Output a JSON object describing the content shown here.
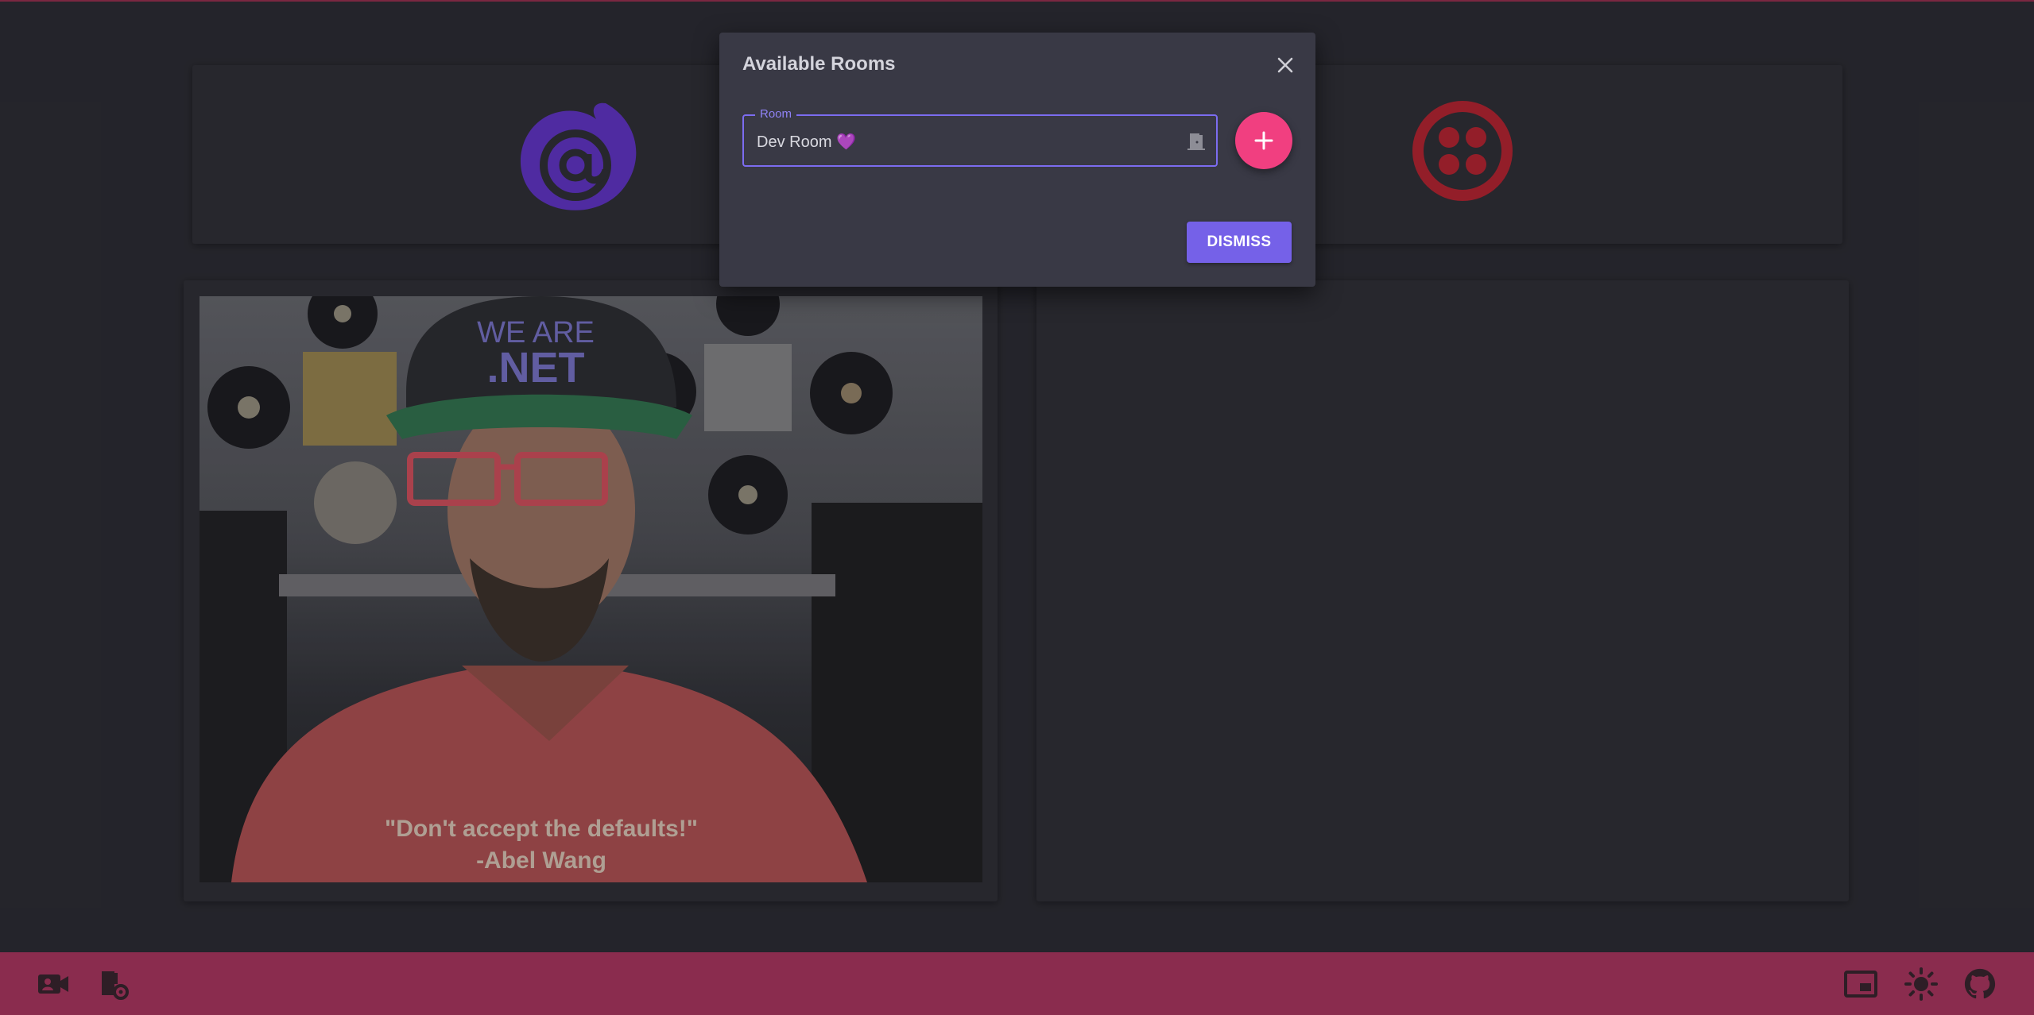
{
  "dialog": {
    "title": "Available Rooms",
    "room_field": {
      "label": "Room",
      "value": "Dev Room 💜",
      "icon": "door-icon"
    },
    "add_button_icon": "plus-icon",
    "close_icon": "close-icon",
    "dismiss_label": "DISMISS"
  },
  "video": {
    "shirt_quote": "\"Don't accept the defaults!\"",
    "shirt_author": "-Abel Wang",
    "hat_top": "WE ARE",
    "hat_bottom": ".NET"
  },
  "logos": {
    "left": "blazor-logo",
    "right": "twilio-logo"
  },
  "bottom_bar": {
    "left_icons": [
      "video-camera-icon",
      "room-settings-icon"
    ],
    "right_icons": [
      "picture-in-picture-icon",
      "brightness-icon",
      "github-icon"
    ]
  },
  "colors": {
    "accent": "#7561e8",
    "fab": "#f13f80",
    "bar": "#8a2c4e",
    "background": "#2a2a31"
  }
}
